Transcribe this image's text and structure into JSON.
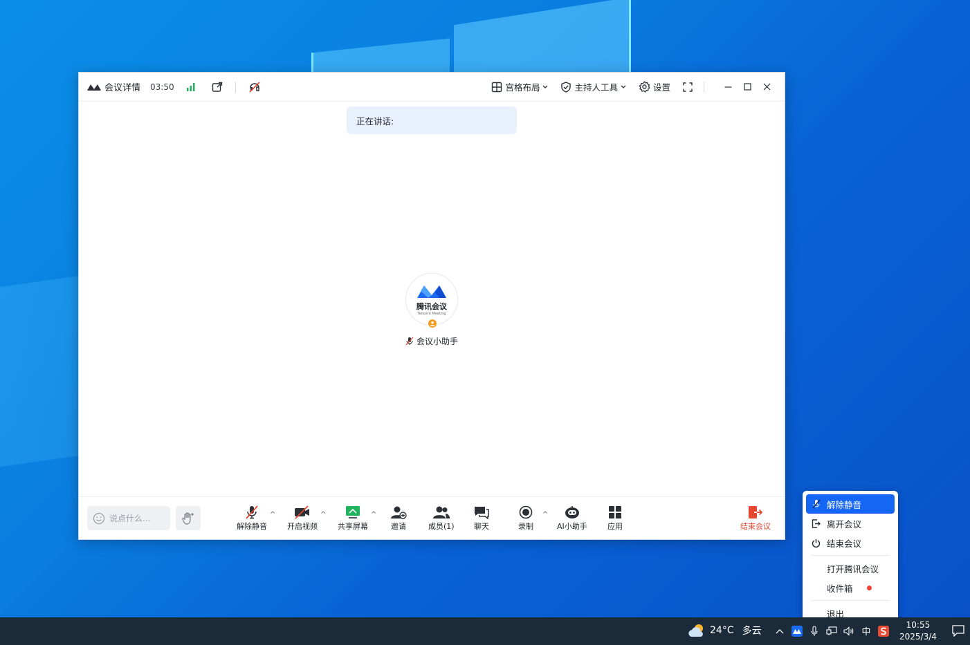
{
  "window": {
    "meeting_details": "会议详情",
    "timer": "03:50",
    "layout_label": "宫格布局",
    "host_tools_label": "主持人工具",
    "settings_label": "设置"
  },
  "stage": {
    "speaking_label": "正在讲话:",
    "participant_name": "会议小助手",
    "avatar_brand": "腾讯会议",
    "avatar_brand_en": "Tencent Meeting"
  },
  "toolbar": {
    "chat_placeholder": "说点什么...",
    "unmute": "解除静音",
    "start_video": "开启视频",
    "share_screen": "共享屏幕",
    "invite": "邀请",
    "members": "成员(1)",
    "chat": "聊天",
    "record": "录制",
    "ai_assistant": "AI小助手",
    "apps": "应用",
    "end_meeting": "结束会议"
  },
  "tray_menu": {
    "unmute": "解除静音",
    "leave": "离开会议",
    "end": "结束会议",
    "open_app": "打开腾讯会议",
    "inbox": "收件箱",
    "exit": "退出"
  },
  "taskbar": {
    "temperature": "24°C",
    "weather": "多云",
    "ime": "中",
    "time": "10:55",
    "date": "2025/3/4"
  },
  "colors": {
    "accent": "#1566f5",
    "danger": "#e5462f",
    "share_green": "#22b35e"
  }
}
